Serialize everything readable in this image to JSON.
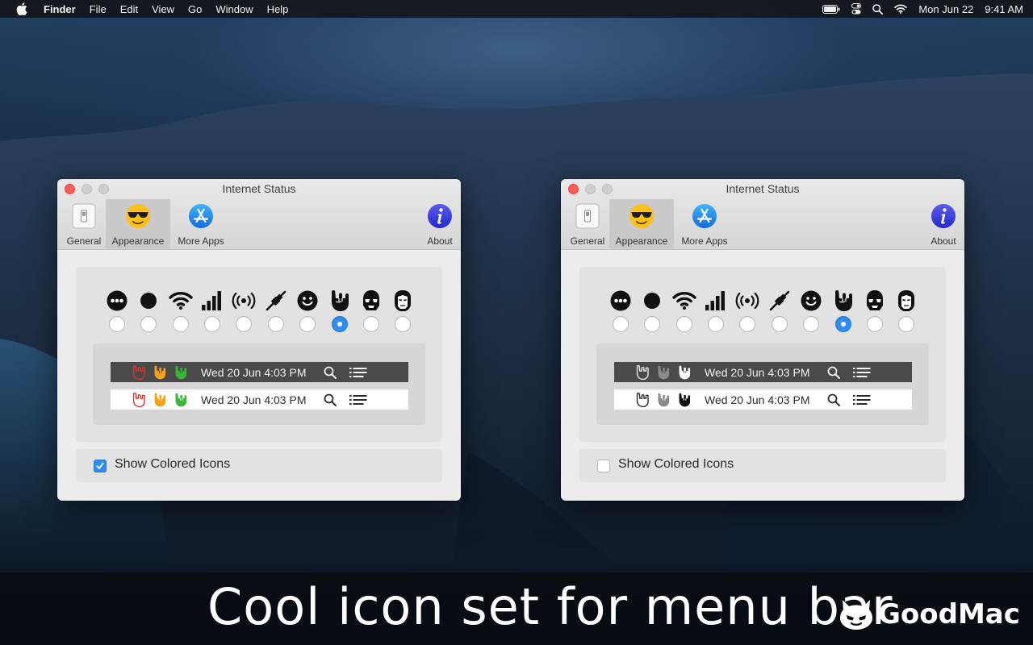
{
  "menubar": {
    "app": "Finder",
    "items": [
      "File",
      "Edit",
      "View",
      "Go",
      "Window",
      "Help"
    ],
    "date": "Mon Jun 22",
    "time": "9:41 AM"
  },
  "window": {
    "title": "Internet Status",
    "toolbar": {
      "general": "General",
      "appearance": "Appearance",
      "more_apps": "More Apps",
      "about": "About"
    },
    "icon_set": [
      "dots-face-icon",
      "dot-icon",
      "wifi-icon",
      "signal-bars-icon",
      "broadcast-icon",
      "plug-icon",
      "smiley-icon",
      "rock-hand-icon",
      "stormtrooper-icon",
      "ironman-icon"
    ],
    "selected_icon_index": 7,
    "preview_clock": "Wed 20 Jun  4:03 PM",
    "option_label": "Show Colored Icons"
  },
  "left_window": {
    "colored": true
  },
  "right_window": {
    "colored": false
  },
  "colors": {
    "hand_red": "#e0352b",
    "hand_orange": "#f2a31b",
    "hand_green": "#3cb43c",
    "accent": "#2f8df2"
  },
  "caption": "Cool icon set for menu bar",
  "brand": "GoodMac"
}
